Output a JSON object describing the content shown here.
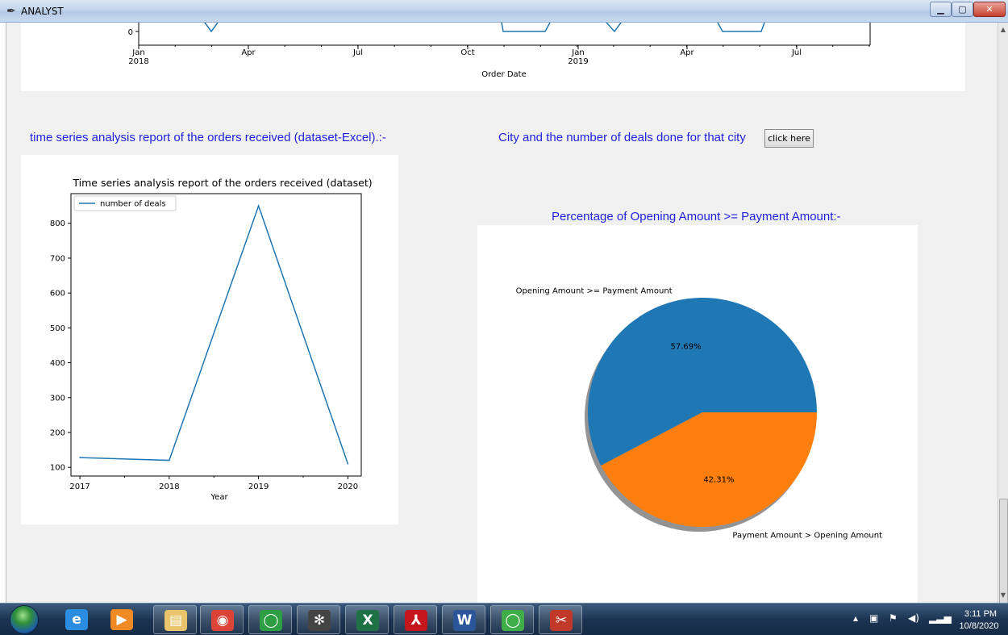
{
  "window": {
    "title": "ANALYST",
    "app_icon": "feather-icon",
    "controls": [
      "minimize-icon",
      "maximize-icon",
      "close-icon"
    ]
  },
  "labels": {
    "timeseries_heading": "time series analysis report of the orders received (dataset-Excel).:-",
    "city_heading": "City and the number of deals done for that city",
    "city_button": "click here",
    "percentage_heading": "Percentage of Opening Amount >= Payment Amount:-"
  },
  "colors": {
    "heading_blue": "#1f1fdd",
    "series_blue": "#1f77b4",
    "pie_orange": "#ff7f0e"
  },
  "chart_data": [
    {
      "type": "line",
      "title": "",
      "xlabel": "Order Date",
      "ylabel": "",
      "ytick_labels": [
        "0"
      ],
      "xtick_labels": [
        {
          "main": "Jan",
          "sub": "2018"
        },
        {
          "main": "Apr",
          "sub": ""
        },
        {
          "main": "Jul",
          "sub": ""
        },
        {
          "main": "Oct",
          "sub": ""
        },
        {
          "main": "Jan",
          "sub": "2019"
        },
        {
          "main": "Apr",
          "sub": ""
        },
        {
          "main": "Jul",
          "sub": ""
        }
      ],
      "note": "partially scrolled out of view; only the bottom edge near y=0 is visible"
    },
    {
      "type": "line",
      "title": "Time series analysis report of the orders received (dataset)",
      "xlabel": "Year",
      "ylabel": "",
      "x": [
        2017,
        2018,
        2019,
        2020
      ],
      "series": [
        {
          "name": "number of deals",
          "values": [
            128,
            120,
            850,
            110
          ]
        }
      ],
      "xticks": [
        2017,
        2018,
        2019,
        2020
      ],
      "yticks": [
        100,
        200,
        300,
        400,
        500,
        600,
        700,
        800
      ],
      "xlim": [
        2016.9,
        2020.15
      ],
      "ylim": [
        75,
        885
      ],
      "legend": "top-left",
      "grid": false
    },
    {
      "type": "pie",
      "title": "",
      "slices": [
        {
          "label": "Opening Amount >= Payment Amount",
          "value": 57.69,
          "pct_label": "57.69%",
          "color": "#1f77b4"
        },
        {
          "label": "Payment Amount > Opening Amount",
          "value": 42.31,
          "pct_label": "42.31%",
          "color": "#ff7f0e"
        }
      ],
      "shadow": true
    }
  ],
  "taskbar": {
    "start": "windows-start-icon",
    "apps": [
      {
        "name": "internet-explorer-icon",
        "glyph": "e",
        "color": "#2b8de0",
        "boxed": false
      },
      {
        "name": "media-player-icon",
        "glyph": "▶",
        "color": "#f08a24",
        "boxed": false
      },
      {
        "name": "file-explorer-icon",
        "glyph": "▤",
        "color": "#e9c46a",
        "boxed": true
      },
      {
        "name": "chrome-icon",
        "glyph": "◉",
        "color": "#db4437",
        "boxed": true
      },
      {
        "name": "refresh-app-icon",
        "glyph": "◯",
        "color": "#2e9e44",
        "boxed": true
      },
      {
        "name": "spider-web-icon",
        "glyph": "✻",
        "color": "#444444",
        "boxed": true
      },
      {
        "name": "excel-icon",
        "glyph": "X",
        "color": "#1e7145",
        "boxed": true
      },
      {
        "name": "acrobat-icon",
        "glyph": "⅄",
        "color": "#c4161c",
        "boxed": true
      },
      {
        "name": "word-icon",
        "glyph": "W",
        "color": "#2b579a",
        "boxed": true
      },
      {
        "name": "python-app-icon",
        "glyph": "◯",
        "color": "#3fae49",
        "boxed": true
      },
      {
        "name": "snipping-tool-icon",
        "glyph": "✂",
        "color": "#c0392b",
        "boxed": true
      }
    ],
    "tray_icons": [
      "show-hidden-icon",
      "network-device-icon",
      "flag-icon",
      "volume-icon",
      "signal-icon"
    ],
    "clock_time": "3:11 PM",
    "clock_date": "10/8/2020"
  }
}
